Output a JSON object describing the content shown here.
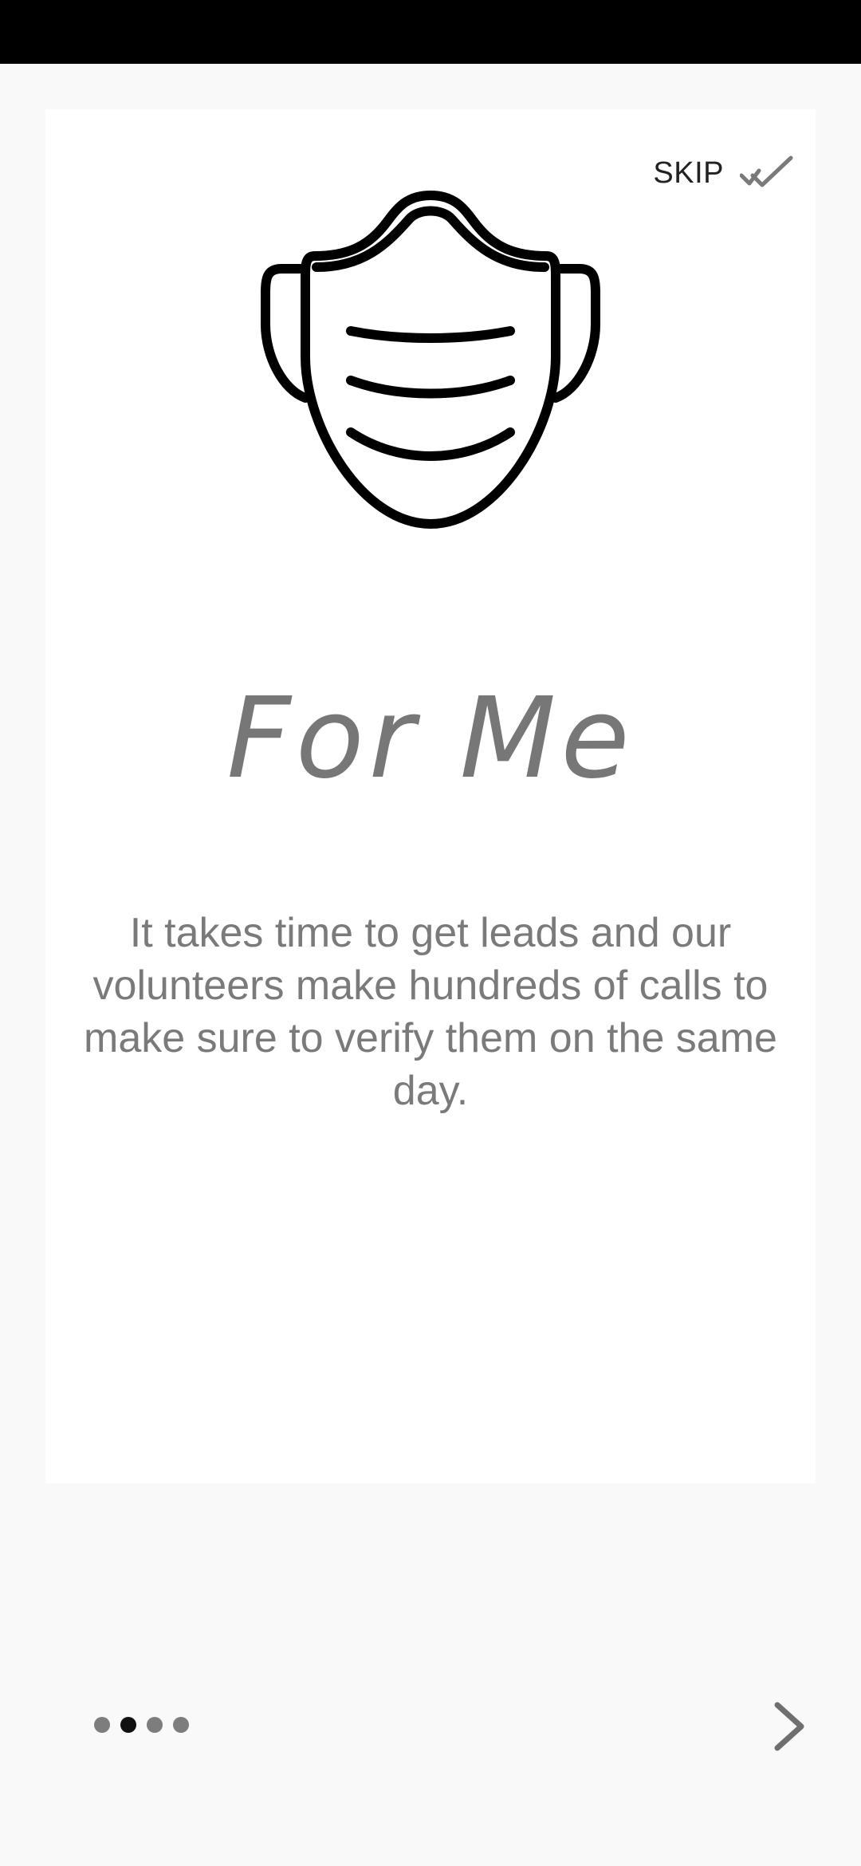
{
  "onboarding": {
    "skip_label": "SKIP",
    "skip_icon": "double-check-icon",
    "illustration_icon": "face-mask-icon",
    "title": "For Me",
    "description": "It takes time to get leads and our volunteers make hundreds of calls to make sure to verify them on the same day.",
    "pager": {
      "total_pages": 4,
      "current_page": 2
    },
    "next_icon": "chevron-right-icon"
  },
  "colors": {
    "background": "#f9f9f9",
    "card": "#ffffff",
    "status_bar": "#000000",
    "title_text": "#777777",
    "body_text": "#7a7a7a",
    "dot_inactive": "#7d7d7d",
    "dot_active": "#111111"
  }
}
